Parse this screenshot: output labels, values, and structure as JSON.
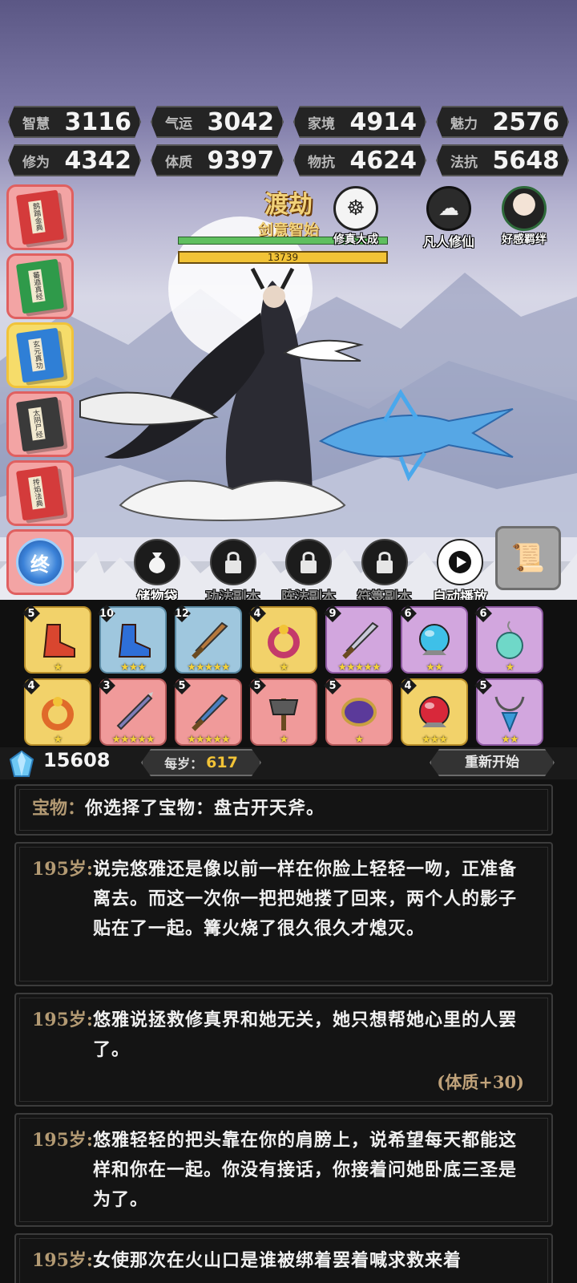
{
  "stats": [
    {
      "label": "智慧",
      "value": "3116"
    },
    {
      "label": "气运",
      "value": "3042"
    },
    {
      "label": "家境",
      "value": "4914"
    },
    {
      "label": "魅力",
      "value": "2576"
    },
    {
      "label": "修为",
      "value": "4342"
    },
    {
      "label": "体质",
      "value": "9397"
    },
    {
      "label": "物抗",
      "value": "4624"
    },
    {
      "label": "法抗",
      "value": "5648"
    }
  ],
  "books": [
    {
      "title": "鹊踏金典",
      "color": "#d43b3b"
    },
    {
      "title": "蕃遁真经",
      "color": "#2f9a4a"
    },
    {
      "title": "玄元真功",
      "color": "#2f7fd6"
    },
    {
      "title": "太阴尸经",
      "color": "#3a3a3a"
    },
    {
      "title": "抟焰法典",
      "color": "#d43b3b"
    }
  ],
  "final_book_label": "终",
  "realm": {
    "title": "渡劫",
    "subtitle": "剑意智始",
    "exp_value": "13739",
    "hp_fraction": 1.0
  },
  "top_icons": [
    {
      "name": "meditate",
      "label": "修真大成"
    },
    {
      "name": "mortal",
      "label": "凡人修仙"
    },
    {
      "name": "affection",
      "label": "好感羁绊"
    }
  ],
  "actions": [
    {
      "label": "储物袋",
      "icon": "bag-icon",
      "locked": false
    },
    {
      "label": "功法副本",
      "icon": "lock-icon",
      "locked": true
    },
    {
      "label": "阵法副本",
      "icon": "lock-icon",
      "locked": true
    },
    {
      "label": "符箓副本",
      "icon": "lock-icon",
      "locked": true
    },
    {
      "label": "自动播放",
      "icon": "play-icon",
      "locked": false
    }
  ],
  "items": [
    {
      "level": "5",
      "stars": 1,
      "rarity": "gold",
      "icon": "boots-icon",
      "color": "#d9462f"
    },
    {
      "level": "10",
      "stars": 3,
      "rarity": "blue",
      "icon": "boots-icon",
      "color": "#2e6fd8"
    },
    {
      "level": "12",
      "stars": 5,
      "rarity": "blue",
      "icon": "sword-icon",
      "color": "#b5793e"
    },
    {
      "level": "4",
      "stars": 1,
      "rarity": "gold",
      "icon": "ring-icon",
      "color": "#c43a6a"
    },
    {
      "level": "9",
      "stars": 5,
      "rarity": "purple",
      "icon": "sword-icon",
      "color": "#c8c8d8"
    },
    {
      "level": "6",
      "stars": 2,
      "rarity": "purple",
      "icon": "orb-icon",
      "color": "#3ec0e8"
    },
    {
      "level": "6",
      "stars": 1,
      "rarity": "purple",
      "icon": "pendant-icon",
      "color": "#6fd8c8"
    },
    {
      "level": "4",
      "stars": 1,
      "rarity": "gold",
      "icon": "ring-icon",
      "color": "#e06a2a"
    },
    {
      "level": "3",
      "stars": 5,
      "rarity": "pink",
      "icon": "spear-icon",
      "color": "#7d7db8"
    },
    {
      "level": "5",
      "stars": 5,
      "rarity": "pink",
      "icon": "sword-icon",
      "color": "#4a7fc0"
    },
    {
      "level": "5",
      "stars": 1,
      "rarity": "pink",
      "icon": "axe-icon",
      "color": "#5a5a5a"
    },
    {
      "level": "5",
      "stars": 1,
      "rarity": "pink",
      "icon": "mirror-icon",
      "color": "#5b3a9a"
    },
    {
      "level": "4",
      "stars": 3,
      "rarity": "gold",
      "icon": "orb-icon",
      "color": "#d8283a"
    },
    {
      "level": "5",
      "stars": 2,
      "rarity": "purple",
      "icon": "necklace-icon",
      "color": "#3a9ad8"
    }
  ],
  "currency": {
    "gem_value": "15608",
    "age_label": "每岁：",
    "age_value": "617",
    "restart_label": "重新开始"
  },
  "log": [
    {
      "tag": "宝物：",
      "text": "你选择了宝物：盘古开天斧。",
      "bonus": ""
    },
    {
      "tag": "195岁:",
      "text": "说完悠雅还是像以前一样在你脸上轻轻一吻，正准备离去。而这一次你一把把她搂了回来，两个人的影子贴在了一起。篝火烧了很久很久才熄灭。",
      "bonus": ""
    },
    {
      "tag": "195岁:",
      "text": "悠雅说拯救修真界和她无关，她只想帮她心里的人罢了。",
      "bonus": "(体质+30)"
    },
    {
      "tag": "195岁:",
      "text": "悠雅轻轻的把头靠在你的肩膀上，说希望每天都能这样和你在一起。你没有接话，你接着问她卧底三圣是为了。",
      "bonus": ""
    },
    {
      "tag": "195岁:",
      "text": "女使那次在火山口是谁被绑着罢着喊求救来着",
      "bonus": ""
    }
  ]
}
